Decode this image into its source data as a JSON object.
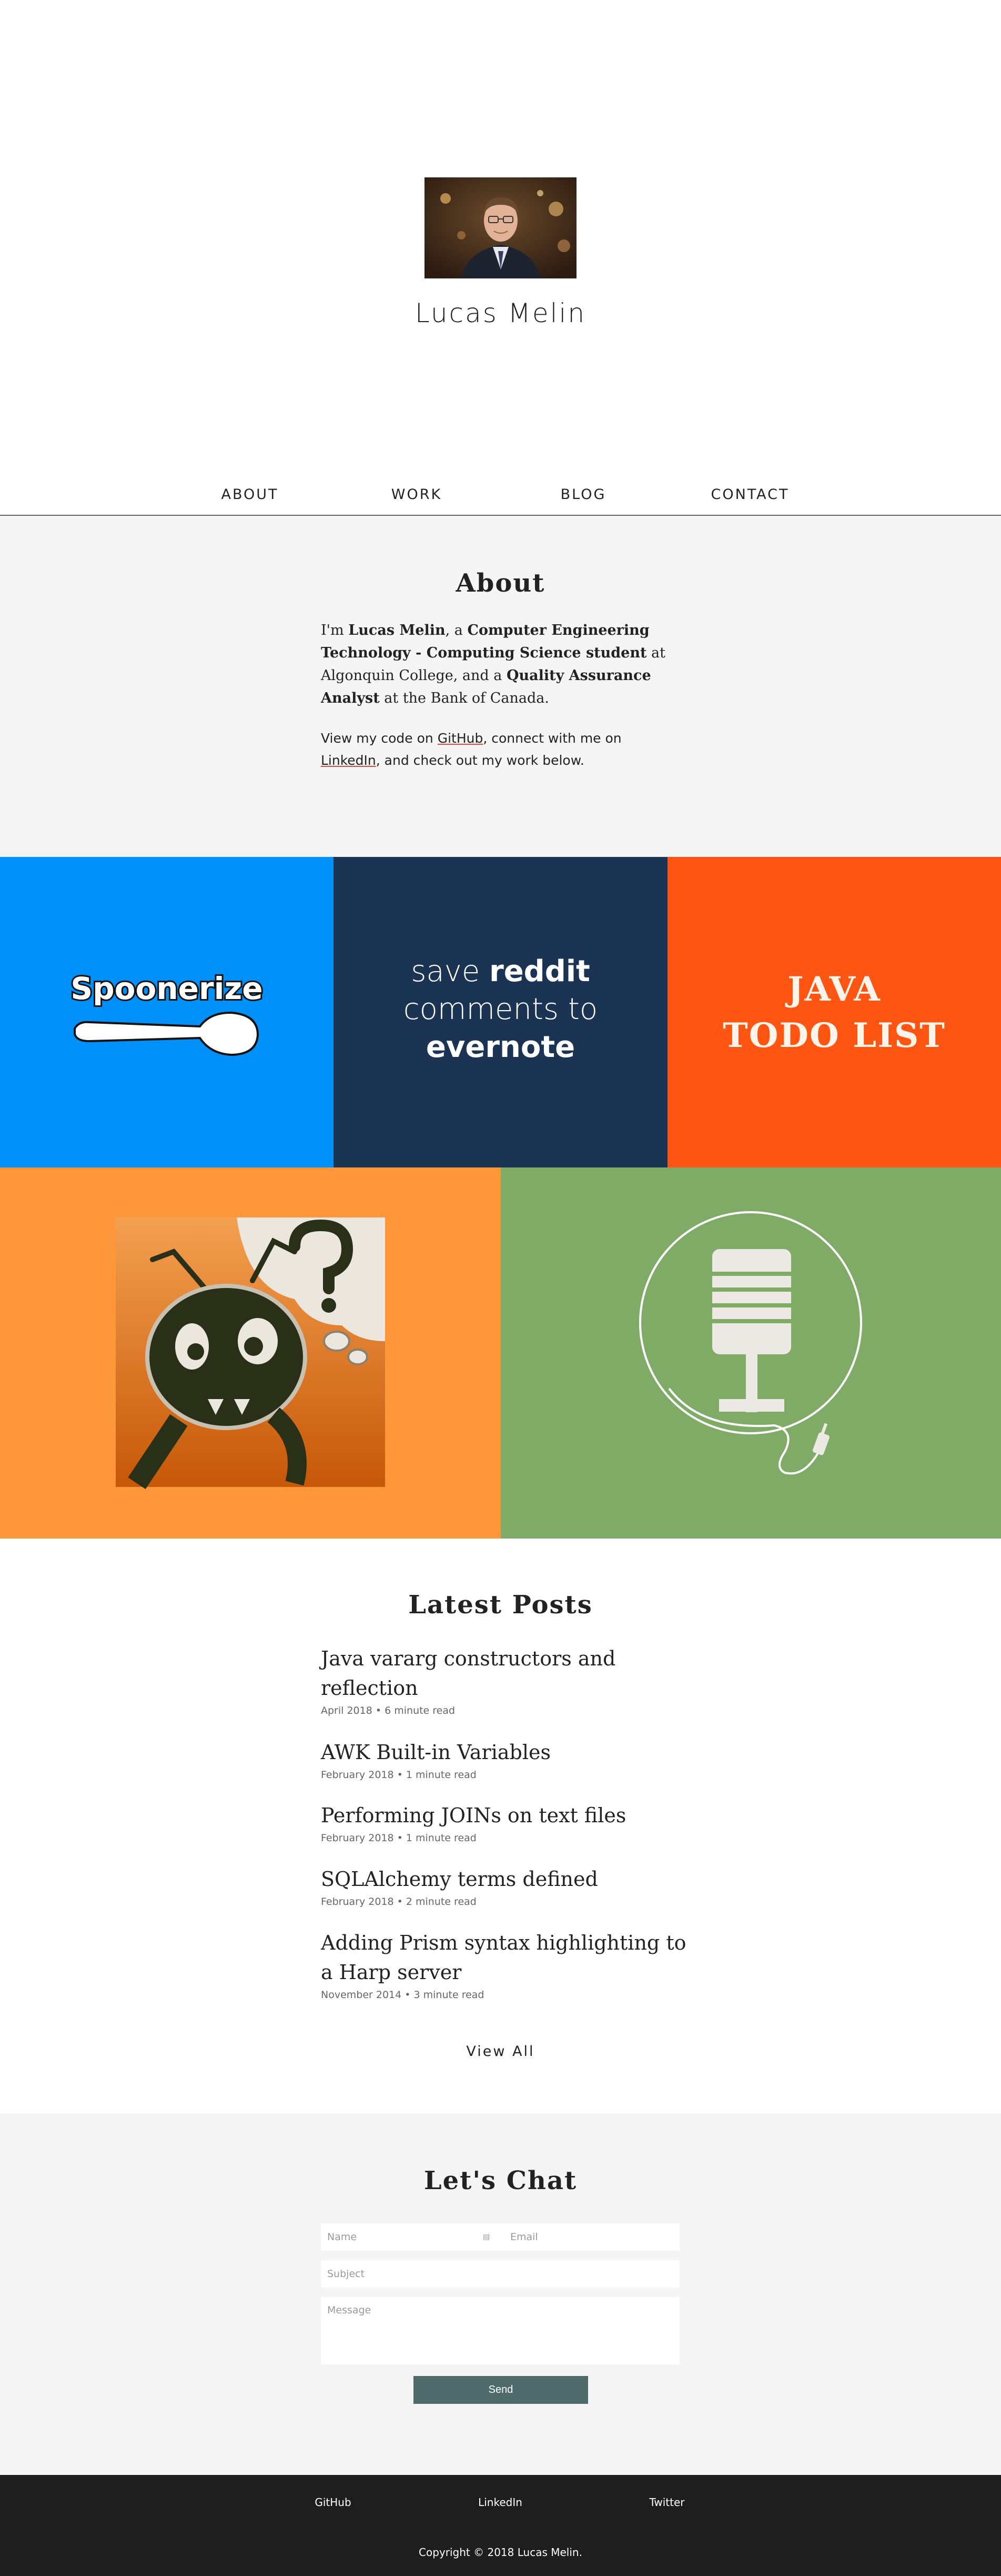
{
  "hero": {
    "name": "Lucas Melin",
    "photo_alt": "Portrait photo"
  },
  "nav": {
    "items": [
      {
        "label": "ABOUT"
      },
      {
        "label": "WORK"
      },
      {
        "label": "BLOG"
      },
      {
        "label": "CONTACT"
      }
    ]
  },
  "about": {
    "title": "About",
    "p1": {
      "t1": "I'm ",
      "b1": "Lucas Melin",
      "t2": ", a ",
      "b2": "Computer Engineering Technology - Computing Science student",
      "t3": " at Algonquin College, and a ",
      "b3": "Quality Assurance Analyst",
      "t4": " at the Bank of Canada."
    },
    "p2": {
      "t1": "View my code on ",
      "link1": "GitHub",
      "t2": ", connect with me on ",
      "link2": "LinkedIn",
      "t3": ", and check out my work below."
    }
  },
  "work": {
    "spoonerize": "Spoonerize",
    "reddit": {
      "line1a": "save ",
      "line1b": "reddit",
      "line2": "comments to",
      "line3": "evernote"
    },
    "java": {
      "line1": "JAVA",
      "line2": "TODO LIST"
    },
    "colors": {
      "spoonerize": "#0090f9",
      "reddit": "#1c3454",
      "java": "#fe5512",
      "ant": "#fe973c",
      "mic": "#80ab66"
    }
  },
  "posts": {
    "title": "Latest Posts",
    "items": [
      {
        "title": "Java vararg constructors and reflection",
        "meta": "April 2018 • 6 minute read"
      },
      {
        "title": "AWK Built-in Variables",
        "meta": "February 2018 • 1 minute read"
      },
      {
        "title": "Performing JOINs on text files",
        "meta": "February 2018 • 1 minute read"
      },
      {
        "title": "SQLAlchemy terms defined",
        "meta": "February 2018 • 2 minute read"
      },
      {
        "title": "Adding Prism syntax highlighting to a Harp server",
        "meta": "November 2014 • 3 minute read"
      }
    ],
    "view_all": "View All"
  },
  "chat": {
    "title": "Let's Chat",
    "name_placeholder": "Name",
    "email_placeholder": "Email",
    "subject_placeholder": "Subject",
    "message_placeholder": "Message",
    "send_label": "Send"
  },
  "footer": {
    "links": [
      {
        "label": "GitHub"
      },
      {
        "label": "LinkedIn"
      },
      {
        "label": "Twitter"
      }
    ],
    "copyright": "Copyright © 2018 Lucas Melin."
  }
}
